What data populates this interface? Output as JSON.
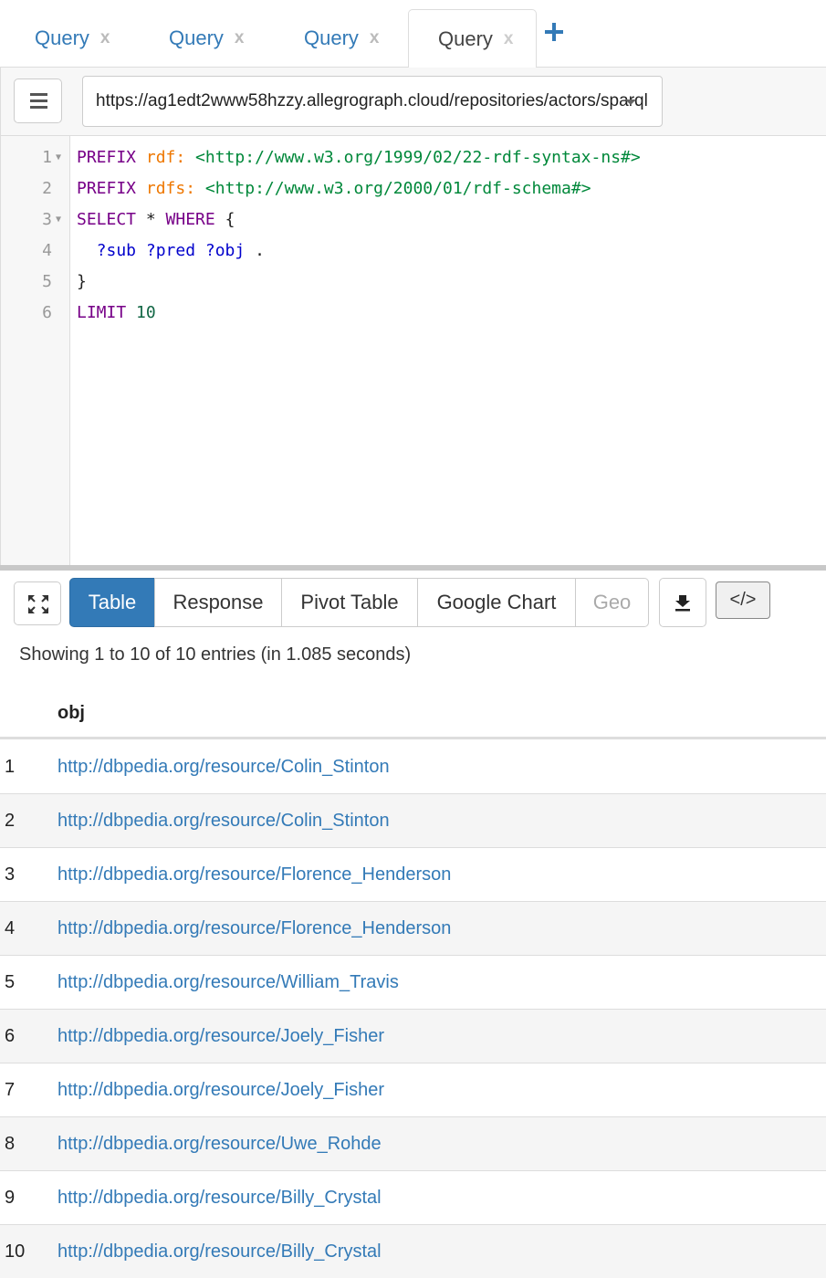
{
  "tabs": [
    {
      "label": "Query",
      "close": "x"
    },
    {
      "label": "Query",
      "close": "x"
    },
    {
      "label": "Query",
      "close": "x"
    },
    {
      "label": "Query",
      "close": "x"
    }
  ],
  "toolbar": {
    "endpoint_url": "https://ag1edt2www58hzzy.allegrograph.cloud/repositories/actors/sparql"
  },
  "editor": {
    "lines": [
      {
        "n": "1",
        "fold": "▼",
        "parts": [
          {
            "t": "PREFIX ",
            "c": "kw"
          },
          {
            "t": "rdf: ",
            "c": "pfx"
          },
          {
            "t": "<http://www.w3.org/1999/02/22-rdf-syntax-ns#>",
            "c": "iri"
          }
        ]
      },
      {
        "n": "2",
        "fold": "",
        "parts": [
          {
            "t": "PREFIX ",
            "c": "kw"
          },
          {
            "t": "rdfs: ",
            "c": "pfx"
          },
          {
            "t": "<http://www.w3.org/2000/01/rdf-schema#>",
            "c": "iri"
          }
        ]
      },
      {
        "n": "3",
        "fold": "▼",
        "parts": [
          {
            "t": "SELECT ",
            "c": "kw"
          },
          {
            "t": "* ",
            "c": "plain"
          },
          {
            "t": "WHERE ",
            "c": "kw"
          },
          {
            "t": "{",
            "c": "plain"
          }
        ]
      },
      {
        "n": "4",
        "fold": "",
        "parts": [
          {
            "t": "  ?sub ?pred ?obj ",
            "c": "var"
          },
          {
            "t": ".",
            "c": "plain"
          }
        ]
      },
      {
        "n": "5",
        "fold": "",
        "parts": [
          {
            "t": "}",
            "c": "plain"
          }
        ]
      },
      {
        "n": "6",
        "fold": "",
        "parts": [
          {
            "t": "LIMIT ",
            "c": "kw"
          },
          {
            "t": "10",
            "c": "num"
          }
        ]
      }
    ]
  },
  "results": {
    "views": [
      "Table",
      "Response",
      "Pivot Table",
      "Google Chart",
      "Geo"
    ],
    "active_view": "Table",
    "code_button": "</>",
    "status": "Showing 1 to 10 of 10 entries (in 1.085 seconds)",
    "column": "obj",
    "rows": [
      {
        "i": "1",
        "v": "http://dbpedia.org/resource/Colin_Stinton"
      },
      {
        "i": "2",
        "v": "http://dbpedia.org/resource/Colin_Stinton"
      },
      {
        "i": "3",
        "v": "http://dbpedia.org/resource/Florence_Henderson"
      },
      {
        "i": "4",
        "v": "http://dbpedia.org/resource/Florence_Henderson"
      },
      {
        "i": "5",
        "v": "http://dbpedia.org/resource/William_Travis"
      },
      {
        "i": "6",
        "v": "http://dbpedia.org/resource/Joely_Fisher"
      },
      {
        "i": "7",
        "v": "http://dbpedia.org/resource/Joely_Fisher"
      },
      {
        "i": "8",
        "v": "http://dbpedia.org/resource/Uwe_Rohde"
      },
      {
        "i": "9",
        "v": "http://dbpedia.org/resource/Billy_Crystal"
      },
      {
        "i": "10",
        "v": "http://dbpedia.org/resource/Billy_Crystal"
      }
    ]
  }
}
